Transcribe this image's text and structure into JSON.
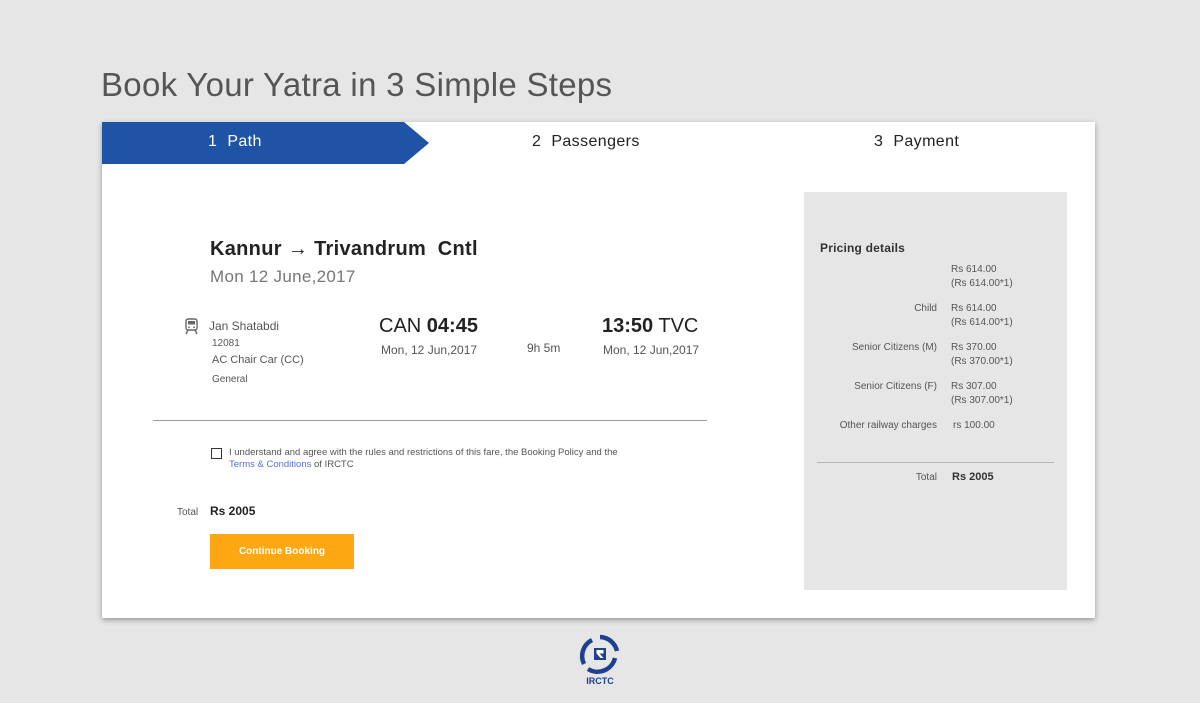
{
  "header": {
    "title": "Book Your Yatra in 3 Simple Steps"
  },
  "steps": [
    {
      "num": "1",
      "label": "Path"
    },
    {
      "num": "2",
      "label": "Passengers"
    },
    {
      "num": "3",
      "label": "Payment"
    }
  ],
  "journey": {
    "from": "Kannur",
    "arrow": "→",
    "to": "Trivandrum  Cntl",
    "date": "Mon 12 June,2017"
  },
  "train": {
    "name": "Jan Shatabdi",
    "number": "12081",
    "class": "AC Chair Car (CC)",
    "quota": "General",
    "icon": "train-icon"
  },
  "departure": {
    "station": "CAN",
    "time": "04:45",
    "date": "Mon, 12 Jun,2017"
  },
  "duration": "9h 5m",
  "arrival": {
    "time": "13:50",
    "station": "TVC",
    "date": "Mon, 12 Jun,2017"
  },
  "agreement": {
    "checked": false,
    "text_before": "I understand and agree with the rules and restrictions of this fare, the Booking Policy and the ",
    "link": "Terms & Conditions",
    "text_after": " of IRCTC"
  },
  "summary": {
    "total_label": "Total",
    "total_value": "Rs 2005",
    "continue_label": "Continue Booking"
  },
  "pricing": {
    "title": "Pricing details",
    "rows": [
      {
        "label": "",
        "amount": "Rs 614.00",
        "calc": "(Rs 614.00*1)"
      },
      {
        "label": "Child",
        "amount": "Rs 614.00",
        "calc": "(Rs 614.00*1)"
      },
      {
        "label": "Senior Citizens (M)",
        "amount": "Rs 370.00",
        "calc": "(Rs 370.00*1)"
      },
      {
        "label": "Senior Citizens (F)",
        "amount": "Rs 307.00",
        "calc": "(Rs 307.00*1)"
      },
      {
        "label": "Other railway charges",
        "amount": "rs 100.00",
        "calc": ""
      }
    ],
    "total_label": "Total",
    "total_value": "Rs 2005"
  },
  "logo": {
    "text": "IRCTC"
  },
  "colors": {
    "step_active": "#1f53a5",
    "button": "#fda713",
    "link": "#5a6fd0",
    "pricing_bg": "#e6e6e6"
  }
}
